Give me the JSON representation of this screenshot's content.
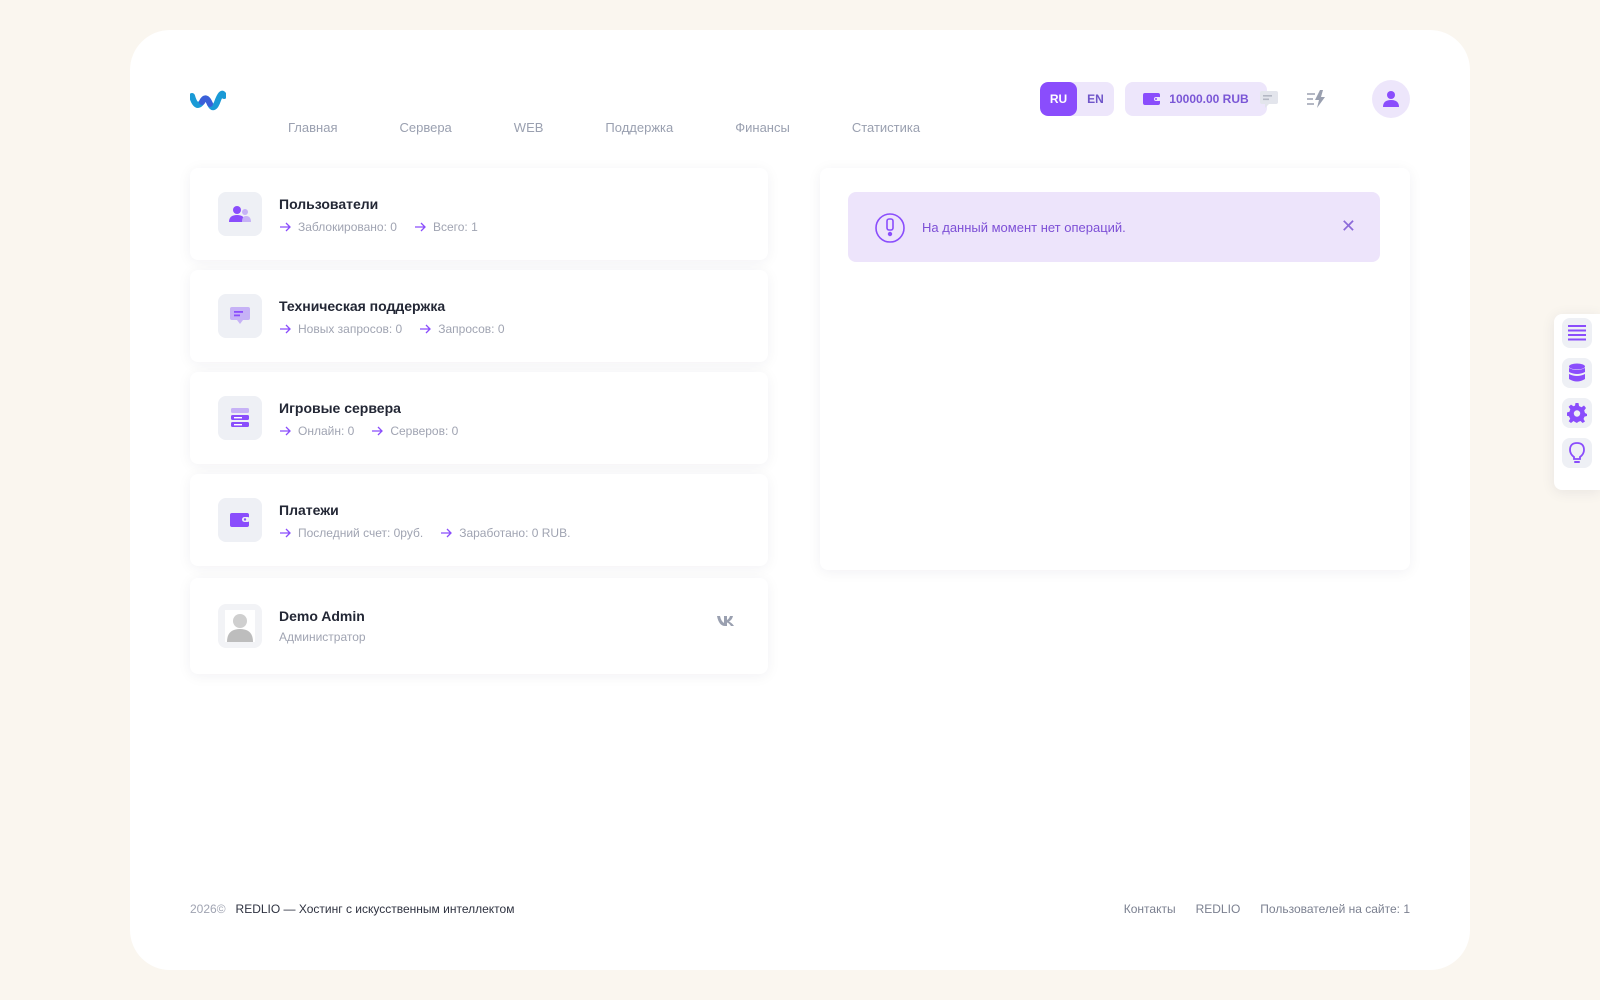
{
  "nav": {
    "items": [
      "Главная",
      "Сервера",
      "WEB",
      "Поддержка",
      "Финансы",
      "Статистика"
    ]
  },
  "header": {
    "lang_ru": "RU",
    "lang_en": "EN",
    "balance": "10000.00 RUB",
    "icons": [
      "chat-icon",
      "lightning-icon",
      "user-icon"
    ]
  },
  "cards": {
    "users": {
      "title": "Пользователи",
      "meta1": "Заблокировано: 0",
      "meta2": "Всего: 1"
    },
    "support": {
      "title": "Техническая поддержка",
      "meta1": "Новых запросов: 0",
      "meta2": "Запросов: 0"
    },
    "servers": {
      "title": "Игровые сервера",
      "meta1": "Онлайн: 0",
      "meta2": "Серверов: 0"
    },
    "payments": {
      "title": "Платежи",
      "meta1": "Последний счет: 0руб.",
      "meta2": "Заработано: 0 RUB."
    },
    "admin": {
      "name": "Demo Admin",
      "role": "Администратор",
      "social": "vk"
    }
  },
  "alert": {
    "text": "На данный момент нет операций.",
    "close": "✕"
  },
  "footer": {
    "year": "2026©",
    "brand": "REDLIO — Хостинг с искусственным интеллектом",
    "links": [
      "Контакты",
      "REDLIO",
      "Пользователей на сайте: 1"
    ]
  },
  "colors": {
    "accent": "#8a4dfc",
    "accent_soft": "#ede6fb",
    "background": "#faf6ef"
  }
}
